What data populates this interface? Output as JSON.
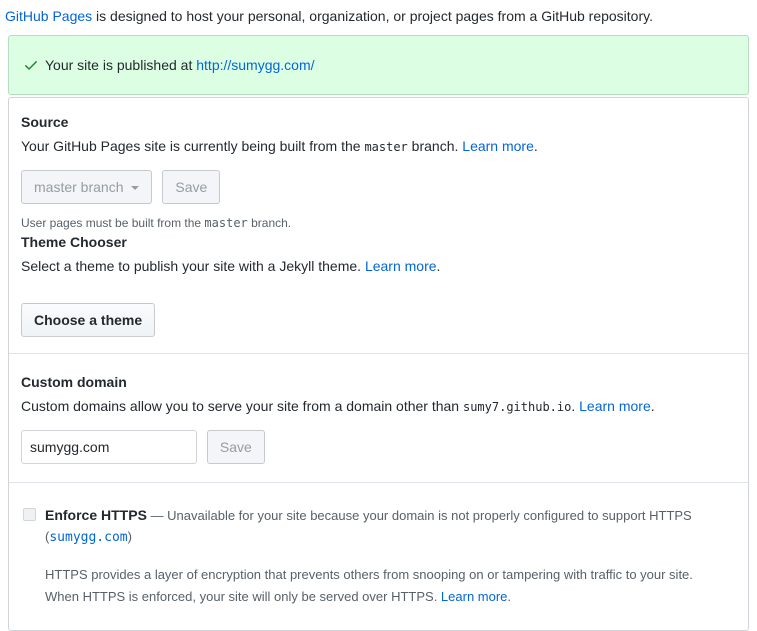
{
  "intro": {
    "link_text": "GitHub Pages",
    "text_after": " is designed to host your personal, organization, or project pages from a GitHub repository."
  },
  "flash": {
    "icon": "check-icon",
    "text": "Your site is published at ",
    "link": "http://sumygg.com/"
  },
  "source": {
    "heading": "Source",
    "desc_before": "Your GitHub Pages site is currently being built from the ",
    "branch_code": "master",
    "desc_after": " branch. ",
    "learn_more": "Learn more",
    "period": ".",
    "branch_button": "master branch",
    "save_button": "Save",
    "note_before": "User pages must be built from the ",
    "note_code": "master",
    "note_after": " branch."
  },
  "theme": {
    "heading": "Theme Chooser",
    "desc": "Select a theme to publish your site with a Jekyll theme. ",
    "learn_more": "Learn more",
    "period": ".",
    "button": "Choose a theme"
  },
  "custom_domain": {
    "heading": "Custom domain",
    "desc_before": "Custom domains allow you to serve your site from a domain other than ",
    "domain_code": "sumy7.github.io",
    "desc_after": ". ",
    "learn_more": "Learn more",
    "period": ".",
    "input_value": "sumygg.com",
    "save_button": "Save"
  },
  "https": {
    "label": "Enforce HTTPS",
    "unavailable_before": " — Unavailable for your site because your domain is not properly configured to support HTTPS (",
    "domain_code": "sumygg.com",
    "unavailable_after": ")",
    "note_line1": "HTTPS provides a layer of encryption that prevents others from snooping on or tampering with traffic to your site.",
    "note_line2": "When HTTPS is enforced, your site will only be served over HTTPS. ",
    "learn_more": "Learn more",
    "period": "."
  },
  "colors": {
    "link_blue": "#0366d6",
    "flash_bg": "#dcffe4",
    "flash_border": "#b5ddc0",
    "check_green": "#22863a",
    "muted_gray": "#586069",
    "box_border": "#d1d5da"
  }
}
